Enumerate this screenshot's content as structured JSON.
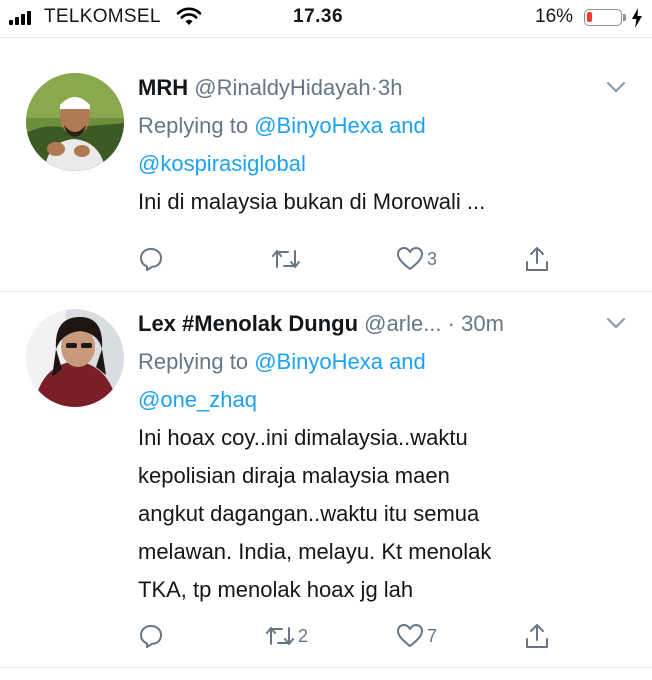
{
  "status_bar": {
    "carrier": "TELKOMSEL",
    "time": "17.36",
    "battery_percent": "16%",
    "battery_level": 0.16,
    "battery_color": "#ff3b30"
  },
  "colors": {
    "link": "#1da1f2",
    "secondary": "#657786",
    "divider": "#e1e8ed"
  },
  "tweets": [
    {
      "name": "MRH",
      "handle": "@RinaldyHidayah",
      "dot": "·",
      "time": "3h",
      "replying_prefix": "Replying to",
      "mention_1": "@BinyoHexa",
      "and": "and",
      "mention_2": "@kospirasiglobal",
      "text": "Ini di malaysia bukan di Morowali ...",
      "reply_count": "",
      "retweet_count": "",
      "like_count": "3",
      "icons": [
        "reply-icon",
        "retweet-icon",
        "heart-icon",
        "share-icon",
        "chevron-down-icon"
      ]
    },
    {
      "name": "Lex #Menolak Dungu",
      "handle": "@arle...",
      "dot": "·",
      "time": "30m",
      "replying_prefix": "Replying to",
      "mention_1": "@BinyoHexa",
      "and": "and",
      "mention_2": "@one_zhaq",
      "text_lines": [
        "Ini hoax coy..ini dimalaysia..waktu",
        "kepolisian diraja malaysia maen",
        "angkut dagangan..waktu itu semua",
        "melawan. India, melayu. Kt menolak",
        "TKA, tp menolak hoax jg lah"
      ],
      "reply_count": "",
      "retweet_count": "2",
      "like_count": "7",
      "icons": [
        "reply-icon",
        "retweet-icon",
        "heart-icon",
        "share-icon",
        "chevron-down-icon"
      ]
    }
  ]
}
